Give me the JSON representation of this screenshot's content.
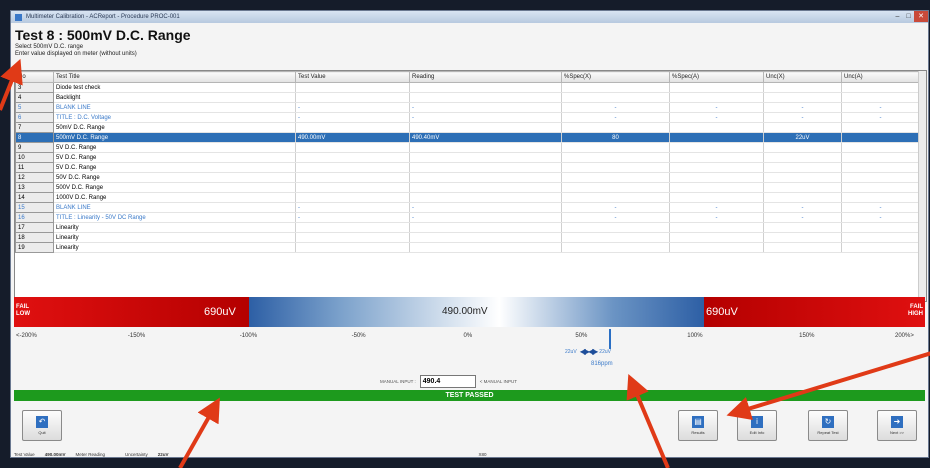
{
  "window": {
    "title": "Multimeter Calibration - ACReport - Procedure PROC-001",
    "controls": [
      "minimize",
      "maximize",
      "close"
    ]
  },
  "heading": "Test 8 : 500mV D.C. Range",
  "instructions": [
    "Select 500mV D.C. range",
    "Enter value displayed on meter (without units)"
  ],
  "table": {
    "columns": [
      "No",
      "Test Title",
      "Test Value",
      "Reading",
      "%Spec(X)",
      "%Spec(A)",
      "Unc(X)",
      "Unc(A)"
    ],
    "rows": [
      {
        "no": "3",
        "title": "Diode test check",
        "value": "",
        "reading": "",
        "specx": "",
        "speca": "",
        "uncx": "",
        "unca": "",
        "style": "normal"
      },
      {
        "no": "4",
        "title": "Backlight",
        "value": "",
        "reading": "",
        "specx": "",
        "speca": "",
        "uncx": "",
        "unca": "",
        "style": "normal"
      },
      {
        "no": "5",
        "title": "BLANK LINE",
        "value": "-",
        "reading": "-",
        "specx": "-",
        "speca": "-",
        "uncx": "-",
        "unca": "-",
        "style": "blue"
      },
      {
        "no": "6",
        "title": "TITLE : D.C. Voltage",
        "value": "-",
        "reading": "-",
        "specx": "-",
        "speca": "-",
        "uncx": "-",
        "unca": "-",
        "style": "blue"
      },
      {
        "no": "7",
        "title": "50mV D.C. Range",
        "value": "",
        "reading": "",
        "specx": "",
        "speca": "",
        "uncx": "",
        "unca": "",
        "style": "normal"
      },
      {
        "no": "8",
        "title": "500mV D.C. Range",
        "value": "490.00mV",
        "reading": "490.40mV",
        "specx": "80",
        "speca": "",
        "uncx": "22uV",
        "unca": "",
        "style": "selected"
      },
      {
        "no": "9",
        "title": "5V D.C. Range",
        "value": "",
        "reading": "",
        "specx": "",
        "speca": "",
        "uncx": "",
        "unca": "",
        "style": "normal"
      },
      {
        "no": "10",
        "title": "5V D.C. Range",
        "value": "",
        "reading": "",
        "specx": "",
        "speca": "",
        "uncx": "",
        "unca": "",
        "style": "normal"
      },
      {
        "no": "11",
        "title": "5V D.C. Range",
        "value": "",
        "reading": "",
        "specx": "",
        "speca": "",
        "uncx": "",
        "unca": "",
        "style": "normal"
      },
      {
        "no": "12",
        "title": "50V D.C. Range",
        "value": "",
        "reading": "",
        "specx": "",
        "speca": "",
        "uncx": "",
        "unca": "",
        "style": "normal"
      },
      {
        "no": "13",
        "title": "500V D.C. Range",
        "value": "",
        "reading": "",
        "specx": "",
        "speca": "",
        "uncx": "",
        "unca": "",
        "style": "normal"
      },
      {
        "no": "14",
        "title": "1000V D.C. Range",
        "value": "",
        "reading": "",
        "specx": "",
        "speca": "",
        "uncx": "",
        "unca": "",
        "style": "normal"
      },
      {
        "no": "15",
        "title": "BLANK LINE",
        "value": "-",
        "reading": "-",
        "specx": "-",
        "speca": "-",
        "uncx": "-",
        "unca": "-",
        "style": "blue"
      },
      {
        "no": "16",
        "title": "TITLE : Linearity - 50V DC Range",
        "value": "-",
        "reading": "-",
        "specx": "-",
        "speca": "-",
        "uncx": "-",
        "unca": "-",
        "style": "blue"
      },
      {
        "no": "17",
        "title": "Linearity",
        "value": "",
        "reading": "",
        "specx": "",
        "speca": "",
        "uncx": "",
        "unca": "",
        "style": "normal"
      },
      {
        "no": "18",
        "title": "Linearity",
        "value": "",
        "reading": "",
        "specx": "",
        "speca": "",
        "uncx": "",
        "unca": "",
        "style": "normal"
      },
      {
        "no": "19",
        "title": "Linearity",
        "value": "",
        "reading": "",
        "specx": "",
        "speca": "",
        "uncx": "",
        "unca": "",
        "style": "normal"
      }
    ]
  },
  "bargraph": {
    "fail_low": [
      "FAIL",
      "LOW"
    ],
    "fail_high": [
      "FAIL",
      "HIGH"
    ],
    "low_limit": "690uV",
    "high_limit": "690uV",
    "center_value": "490.00mV",
    "scale": [
      "<-200%",
      "-150%",
      "-100%",
      "-50%",
      "0%",
      "50%",
      "100%",
      "150%",
      "200%>"
    ],
    "reading_percent": 60
  },
  "tolerance": {
    "minus": "22uV",
    "plus": "22uV",
    "ppm": "816ppm"
  },
  "manual": {
    "left_label": "MANUAL INPUT :",
    "value": "490.4",
    "right_label": "< MANUAL INPUT"
  },
  "result": "TEST PASSED",
  "buttons": {
    "quit": "Quit",
    "results": "Results",
    "edit_info": "Edit Info",
    "repeat": "Repeat Test",
    "next": "Next >>"
  },
  "statusbar": {
    "test_value_label": "Test Value",
    "test_value": "490.00mV",
    "reading_label": "Meter Reading",
    "reading": "",
    "uncertainty_label": "Uncertainty",
    "uncertainty": "22uV",
    "extra": "X80"
  },
  "colors": {
    "fail": "#d40000",
    "pass": "#1d9a1d",
    "selection": "#2d6fb6",
    "annotation": "#e03a17"
  }
}
